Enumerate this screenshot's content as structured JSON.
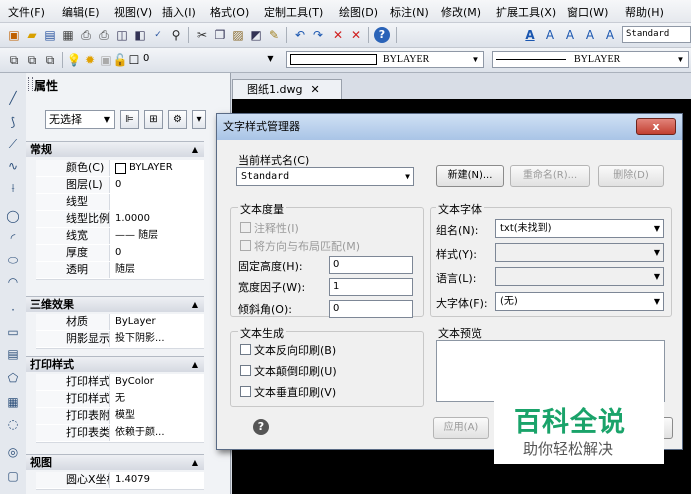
{
  "menu": [
    "文件(F)",
    "编辑(E)",
    "视图(V)",
    "插入(I)",
    "格式(O)",
    "定制工具(T)",
    "绘图(D)",
    "标注(N)",
    "修改(M)",
    "扩展工具(X)",
    "窗口(W)",
    "帮助(H)"
  ],
  "toolbar": {
    "style_combo": "Standard",
    "layer_combo": "0",
    "color_combo": "BYLAYER",
    "linetype_combo": "BYLAYER"
  },
  "properties": {
    "title": "属性",
    "selection": "无选择",
    "sections": {
      "general": "常规",
      "three_d": "三维效果",
      "plot": "打印样式",
      "view": "视图"
    },
    "general_rows": [
      {
        "key": "颜色(C)",
        "value": "BYLAYER"
      },
      {
        "key": "图层(L)",
        "value": "0"
      },
      {
        "key": "线型",
        "value": ""
      },
      {
        "key": "线型比例",
        "value": "1.0000"
      },
      {
        "key": "线宽",
        "value": "—— 随层"
      },
      {
        "key": "厚度",
        "value": "0"
      },
      {
        "key": "透明",
        "value": "随层"
      }
    ],
    "three_d_rows": [
      {
        "key": "材质",
        "value": "ByLayer"
      },
      {
        "key": "阴影显示",
        "value": "投下阴影..."
      }
    ],
    "plot_rows": [
      {
        "key": "打印样式",
        "value": "ByColor"
      },
      {
        "key": "打印样式表",
        "value": "无"
      },
      {
        "key": "打印表附加到",
        "value": "模型"
      },
      {
        "key": "打印表类型",
        "value": "依赖于颜..."
      }
    ],
    "view_rows": [
      {
        "key": "圆心X坐标",
        "value": "1.4079"
      }
    ]
  },
  "document_tab": "图纸1.dwg",
  "dialog": {
    "title": "文字样式管理器",
    "close": "x",
    "current_style_label": "当前样式名(C)",
    "current_style": "Standard",
    "new_button": "新建(N)...",
    "rename_button": "重命名(R)...",
    "delete_button": "删除(D)",
    "metrics_group": "文本度量",
    "annotative_label": "注释性(I)",
    "match_layout_label": "将方向与布局匹配(M)",
    "fixed_height_label": "固定高度(H):",
    "fixed_height_value": "0",
    "width_factor_label": "宽度因子(W):",
    "width_factor_value": "1",
    "oblique_label": "倾斜角(O):",
    "oblique_value": "0",
    "font_group": "文本字体",
    "font_name_label": "组名(N):",
    "font_name_value": "txt(未找到)",
    "font_style_label": "样式(Y):",
    "font_style_value": "",
    "language_label": "语言(L):",
    "language_value": "",
    "bigfont_label": "大字体(F):",
    "bigfont_value": "(无)",
    "generation_group": "文本生成",
    "backwards_label": "文本反向印刷(B)",
    "upside_label": "文本颠倒印刷(U)",
    "vertical_label": "文本垂直印刷(V)",
    "preview_group": "文本预览",
    "apply_button": "应用(A)"
  },
  "watermark": {
    "title": "百科全说",
    "subtitle": "助你轻松解决"
  }
}
